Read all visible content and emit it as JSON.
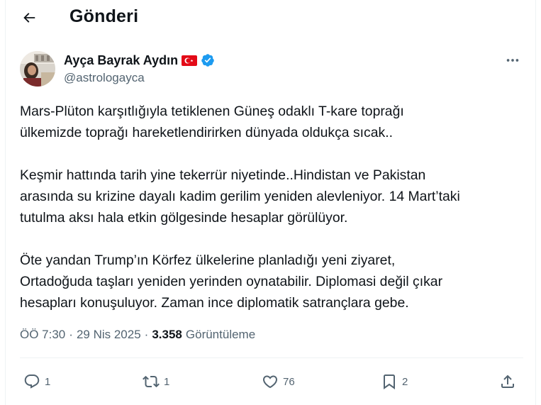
{
  "header": {
    "title": "Gönderi"
  },
  "author": {
    "name": "Ayça Bayrak Aydın",
    "handle": "@astrologayca"
  },
  "post": {
    "lines": [
      "Mars-Plüton karşıtlığıyla tetiklenen Güneş odaklı T-kare toprağı",
      "ülkemizde toprağı hareketlendirirken dünyada oldukça sıcak..",
      "",
      "Keşmir hattında tarih yine tekerrür niyetinde..Hindistan ve Pakistan",
      "arasında su krizine dayalı kadim gerilim yeniden alevleniyor. 14 Mart’taki",
      "tutulma aksı hala etkin gölgesinde hesaplar görülüyor.",
      "",
      "Öte yandan Trump’ın Körfez ülkelerine planladığı yeni ziyaret,",
      "Ortadoğuda taşları yeniden yerinden oynatabilir. Diplomasi değil çıkar",
      "hesapları konuşuluyor. Zaman ince diplomatik satrançlara gebe."
    ]
  },
  "meta": {
    "time": "ÖÖ 7:30",
    "separator": "·",
    "date": "29 Nis 2025",
    "views_count": "3.358",
    "views_label": "Görüntüleme"
  },
  "actions": {
    "replies": "1",
    "reposts": "1",
    "likes": "76",
    "bookmarks": "2"
  },
  "icons": {
    "back": "arrow-left-icon",
    "verified": "verified-badge-icon",
    "flag": "turkey-flag-icon",
    "more": "more-horizontal-icon",
    "reply": "reply-icon",
    "repost": "repost-icon",
    "like": "heart-icon",
    "bookmark": "bookmark-icon",
    "share": "share-icon"
  },
  "colors": {
    "verified": "#1d9bf0",
    "secondary_text": "#536471",
    "primary_text": "#0f1419",
    "flag_red": "#e30a17"
  }
}
